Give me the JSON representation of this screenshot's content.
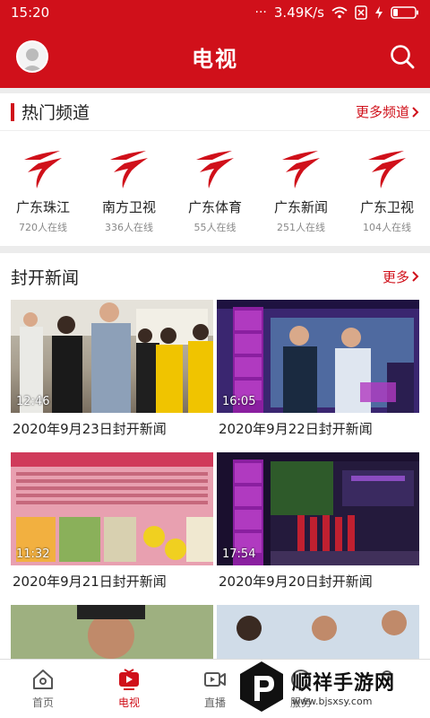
{
  "status": {
    "time": "15:20",
    "speed": "3.49K/s"
  },
  "header": {
    "title": "电视"
  },
  "hot": {
    "title": "热门频道",
    "more": "更多频道",
    "channels": [
      {
        "name": "广东珠江",
        "count": "720人在线"
      },
      {
        "name": "南方卫视",
        "count": "336人在线"
      },
      {
        "name": "广东体育",
        "count": "55人在线"
      },
      {
        "name": "广东新闻",
        "count": "251人在线"
      },
      {
        "name": "广东卫视",
        "count": "104人在线"
      }
    ]
  },
  "news": {
    "title": "封开新闻",
    "more": "更多",
    "items": [
      {
        "duration": "12:46",
        "caption": "2020年9月23日封开新闻"
      },
      {
        "duration": "16:05",
        "caption": "2020年9月22日封开新闻"
      },
      {
        "duration": "11:32",
        "caption": "2020年9月21日封开新闻"
      },
      {
        "duration": "17:54",
        "caption": "2020年9月20日封开新闻"
      }
    ]
  },
  "nav": [
    {
      "label": "首页"
    },
    {
      "label": "电视"
    },
    {
      "label": "直播"
    },
    {
      "label": "服务"
    }
  ],
  "watermark": {
    "brand": "顺祥手游网",
    "url": "www.bjsxsy.com"
  }
}
